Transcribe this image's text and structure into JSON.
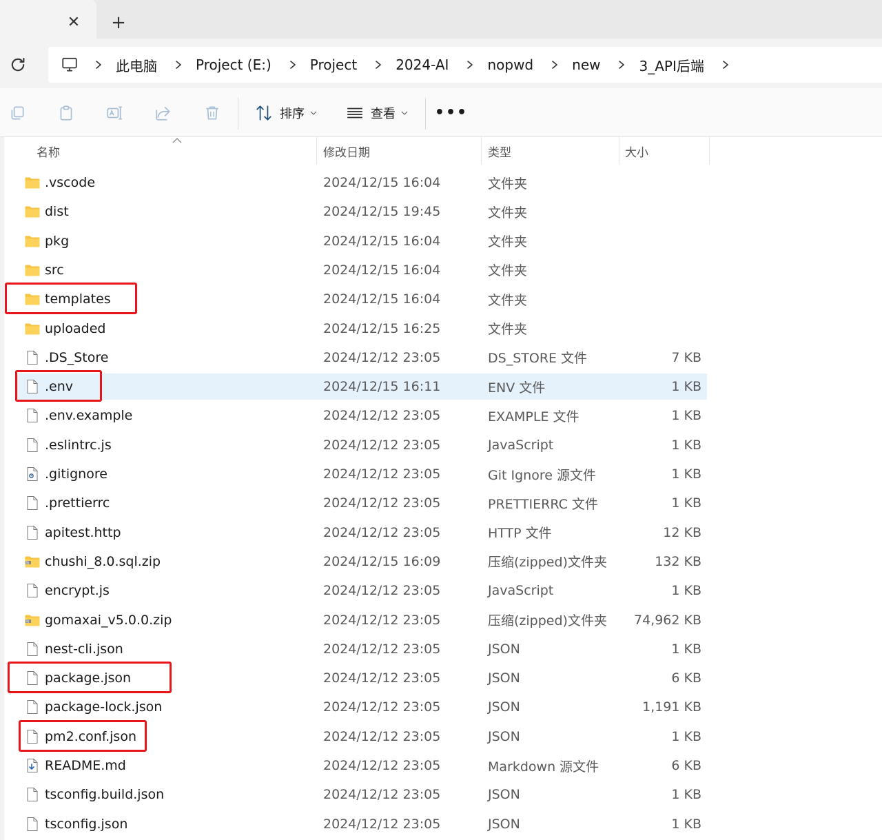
{
  "tabbar": {
    "close_glyph": "✕",
    "new_tab_glyph": "+"
  },
  "breadcrumb": {
    "items": [
      "此电脑",
      "Project (E:)",
      "Project",
      "2024-AI",
      "nopwd",
      "new",
      "3_API后端"
    ]
  },
  "toolbar": {
    "sort_label": "排序",
    "view_label": "查看",
    "more_glyph": "•••",
    "icons": [
      "copy-icon",
      "paste-icon",
      "rename-icon",
      "share-icon",
      "delete-icon"
    ]
  },
  "columns": {
    "name": "名称",
    "date": "修改日期",
    "type": "类型",
    "size": "大小"
  },
  "files": [
    {
      "name": ".vscode",
      "date": "2024/12/15 16:04",
      "type": "文件夹",
      "size": "",
      "icon": "folder-icon"
    },
    {
      "name": "dist",
      "date": "2024/12/15 19:45",
      "type": "文件夹",
      "size": "",
      "icon": "folder-icon"
    },
    {
      "name": "pkg",
      "date": "2024/12/15 16:04",
      "type": "文件夹",
      "size": "",
      "icon": "folder-icon"
    },
    {
      "name": "src",
      "date": "2024/12/15 16:04",
      "type": "文件夹",
      "size": "",
      "icon": "folder-icon"
    },
    {
      "name": "templates",
      "date": "2024/12/15 16:04",
      "type": "文件夹",
      "size": "",
      "icon": "folder-icon"
    },
    {
      "name": "uploaded",
      "date": "2024/12/15 16:25",
      "type": "文件夹",
      "size": "",
      "icon": "folder-icon"
    },
    {
      "name": ".DS_Store",
      "date": "2024/12/12 23:05",
      "type": "DS_STORE 文件",
      "size": "7 KB",
      "icon": "file-icon"
    },
    {
      "name": ".env",
      "date": "2024/12/15 16:11",
      "type": "ENV 文件",
      "size": "1 KB",
      "icon": "file-icon",
      "selected": true
    },
    {
      "name": ".env.example",
      "date": "2024/12/12 23:05",
      "type": "EXAMPLE 文件",
      "size": "1 KB",
      "icon": "file-icon"
    },
    {
      "name": ".eslintrc.js",
      "date": "2024/12/12 23:05",
      "type": "JavaScript",
      "size": "1 KB",
      "icon": "file-icon"
    },
    {
      "name": ".gitignore",
      "date": "2024/12/12 23:05",
      "type": "Git Ignore 源文件",
      "size": "1 KB",
      "icon": "gear-file-icon"
    },
    {
      "name": ".prettierrc",
      "date": "2024/12/12 23:05",
      "type": "PRETTIERRC 文件",
      "size": "1 KB",
      "icon": "file-icon"
    },
    {
      "name": "apitest.http",
      "date": "2024/12/12 23:05",
      "type": "HTTP 文件",
      "size": "12 KB",
      "icon": "file-icon"
    },
    {
      "name": "chushi_8.0.sql.zip",
      "date": "2024/12/15 16:09",
      "type": "压缩(zipped)文件夹",
      "size": "132 KB",
      "icon": "zip-folder-icon"
    },
    {
      "name": "encrypt.js",
      "date": "2024/12/12 23:05",
      "type": "JavaScript",
      "size": "1 KB",
      "icon": "file-icon"
    },
    {
      "name": "gomaxai_v5.0.0.zip",
      "date": "2024/12/12 23:05",
      "type": "压缩(zipped)文件夹",
      "size": "74,962 KB",
      "icon": "zip-folder-icon"
    },
    {
      "name": "nest-cli.json",
      "date": "2024/12/12 23:05",
      "type": "JSON",
      "size": "1 KB",
      "icon": "file-icon"
    },
    {
      "name": "package.json",
      "date": "2024/12/12 23:05",
      "type": "JSON",
      "size": "6 KB",
      "icon": "file-icon"
    },
    {
      "name": "package-lock.json",
      "date": "2024/12/12 23:05",
      "type": "JSON",
      "size": "1,191 KB",
      "icon": "file-icon"
    },
    {
      "name": "pm2.conf.json",
      "date": "2024/12/12 23:05",
      "type": "JSON",
      "size": "1 KB",
      "icon": "file-icon"
    },
    {
      "name": "README.md",
      "date": "2024/12/12 23:05",
      "type": "Markdown 源文件",
      "size": "6 KB",
      "icon": "download-file-icon"
    },
    {
      "name": "tsconfig.build.json",
      "date": "2024/12/12 23:05",
      "type": "JSON",
      "size": "1 KB",
      "icon": "file-icon"
    },
    {
      "name": "tsconfig.json",
      "date": "2024/12/12 23:05",
      "type": "JSON",
      "size": "1 KB",
      "icon": "file-icon"
    }
  ],
  "highlighted_items": [
    "templates",
    ".env",
    "package.json",
    "pm2.conf.json"
  ],
  "colors": {
    "highlight": "#e8161b",
    "selection": "#e5f1fb",
    "folder": "#f6c343"
  }
}
